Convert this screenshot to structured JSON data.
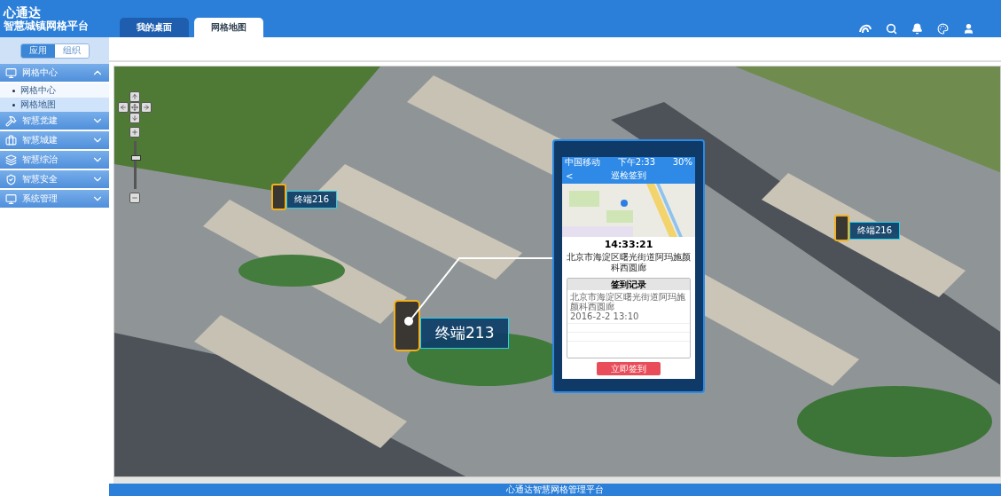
{
  "header": {
    "brand": "心通达",
    "subtitle": "智慧城镇网格平台"
  },
  "tabs": [
    {
      "label": "我的桌面",
      "selected": false
    },
    {
      "label": "网格地图",
      "selected": true
    }
  ],
  "sidebar": {
    "toggle": [
      {
        "label": "应用",
        "selected": true
      },
      {
        "label": "组织",
        "selected": false
      }
    ],
    "menu": [
      {
        "label": "网格中心",
        "kind": "monitor",
        "expanded": true,
        "children": [
          {
            "label": "网格中心",
            "selected": false
          },
          {
            "label": "网格地图",
            "selected": true
          }
        ]
      },
      {
        "label": "智慧党建",
        "kind": "party",
        "expanded": false
      },
      {
        "label": "智慧城建",
        "kind": "briefcase",
        "expanded": false
      },
      {
        "label": "智慧综治",
        "kind": "layers",
        "expanded": false
      },
      {
        "label": "智慧安全",
        "kind": "shield",
        "expanded": false
      },
      {
        "label": "系统管理",
        "kind": "monitor",
        "expanded": false
      }
    ]
  },
  "map": {
    "zoom": {
      "level": 0.68
    },
    "markers": [
      {
        "label": "终端216",
        "kind": "small"
      },
      {
        "label": "终端216",
        "kind": "small"
      },
      {
        "label": "终端213",
        "kind": "large"
      }
    ],
    "popup": {
      "status_bar": {
        "carrier": "中国移动",
        "time": "下午2:33",
        "battery": "30%"
      },
      "back": "<",
      "title": "巡检签到",
      "time": "14:33:21",
      "address": "北京市海淀区曙光街道阿玛施颜科西圆廊",
      "records_title": "签到记录",
      "records": [
        {
          "place": "北京市海淀区曙光街道阿玛施颜科西圆廊",
          "date": "2016-2-2 13:10"
        }
      ],
      "button": "立即签到"
    }
  },
  "footer": "心通达智慧网格管理平台"
}
